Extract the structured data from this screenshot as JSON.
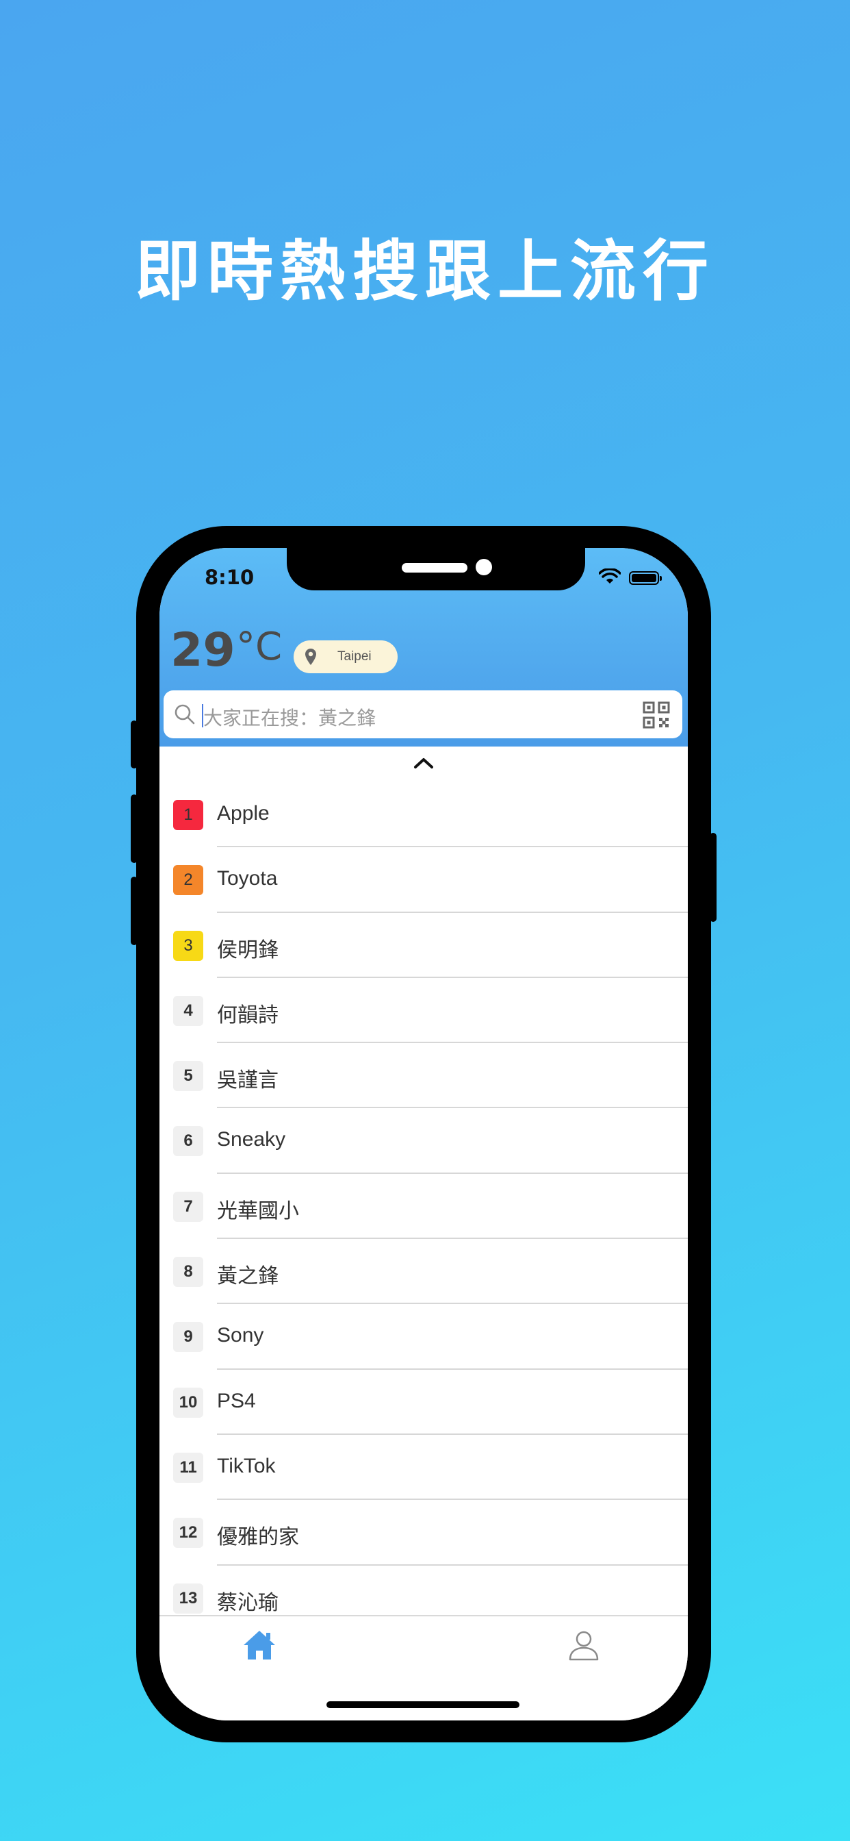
{
  "headline": "即時熱搜跟上流行",
  "status_bar": {
    "time": "8:10"
  },
  "weather": {
    "temperature": "29",
    "unit": "°C",
    "location": "Taipei"
  },
  "search": {
    "placeholder": "大家正在搜：黃之鋒"
  },
  "trending": [
    {
      "rank": "1",
      "term": "Apple",
      "badge_color": "#f5283e"
    },
    {
      "rank": "2",
      "term": "Toyota",
      "badge_color": "#f4862a"
    },
    {
      "rank": "3",
      "term": "侯明鋒",
      "badge_color": "#f7d916"
    },
    {
      "rank": "4",
      "term": "何韻詩",
      "badge_color": "#f0f0f0"
    },
    {
      "rank": "5",
      "term": "吳謹言",
      "badge_color": "#f0f0f0"
    },
    {
      "rank": "6",
      "term": "Sneaky",
      "badge_color": "#f0f0f0"
    },
    {
      "rank": "7",
      "term": "光華國小",
      "badge_color": "#f0f0f0"
    },
    {
      "rank": "8",
      "term": "黃之鋒",
      "badge_color": "#f0f0f0"
    },
    {
      "rank": "9",
      "term": "Sony",
      "badge_color": "#f0f0f0"
    },
    {
      "rank": "10",
      "term": "PS4",
      "badge_color": "#f0f0f0"
    },
    {
      "rank": "11",
      "term": "TikTok",
      "badge_color": "#f0f0f0"
    },
    {
      "rank": "12",
      "term": "優雅的家",
      "badge_color": "#f0f0f0"
    },
    {
      "rank": "13",
      "term": "蔡沁瑜",
      "badge_color": "#f0f0f0"
    }
  ],
  "tabs": [
    {
      "icon": "home-icon",
      "active": true
    },
    {
      "icon": "profile-icon",
      "active": false
    }
  ],
  "colors": {
    "accent": "#4a9ce8",
    "header_top": "#5cbcf6",
    "location_pill": "#fbf4d9"
  }
}
